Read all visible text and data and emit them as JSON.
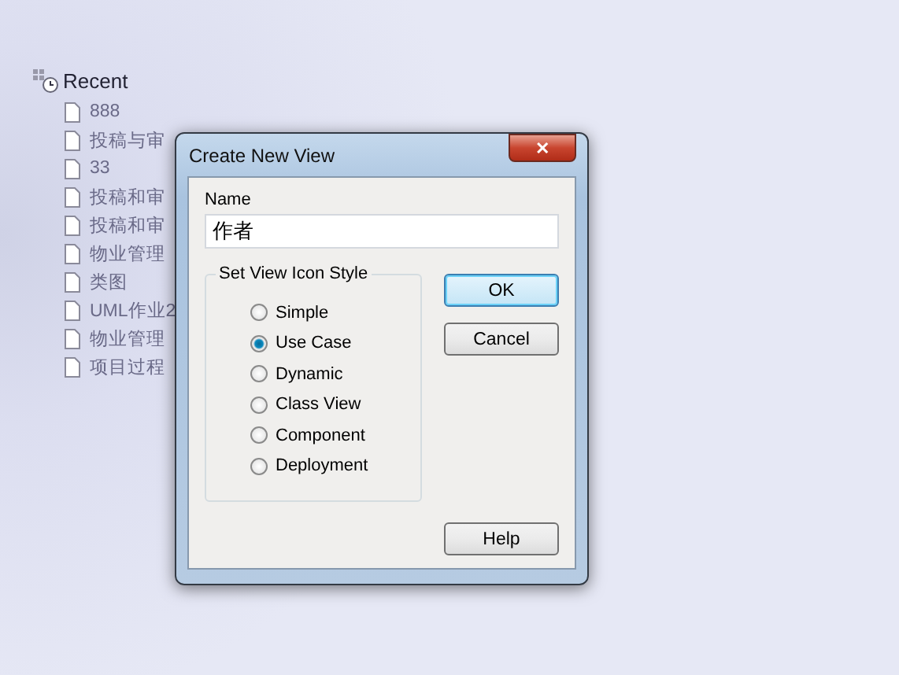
{
  "tree": {
    "label": "Recent",
    "items": [
      {
        "label": "888"
      },
      {
        "label": "投稿与审"
      },
      {
        "label": "33"
      },
      {
        "label": "投稿和审"
      },
      {
        "label": "投稿和审"
      },
      {
        "label": "物业管理"
      },
      {
        "label": "类图"
      },
      {
        "label": "UML作业2"
      },
      {
        "label": "物业管理"
      },
      {
        "label": "项目过程"
      }
    ]
  },
  "dialog": {
    "title": "Create New View",
    "close": "✕",
    "name_label": "Name",
    "name_value": "作者",
    "group_label": "Set View Icon Style",
    "options": [
      {
        "label": "Simple",
        "selected": false
      },
      {
        "label": "Use Case",
        "selected": true
      },
      {
        "label": "Dynamic",
        "selected": false
      },
      {
        "label": "Class View",
        "selected": false
      },
      {
        "label": "Component",
        "selected": false
      },
      {
        "label": "Deployment",
        "selected": false
      }
    ],
    "buttons": [
      {
        "label": "OK",
        "kind": "default"
      },
      {
        "label": "Cancel",
        "kind": "normal"
      },
      {
        "label": "Help",
        "kind": "help"
      }
    ]
  }
}
